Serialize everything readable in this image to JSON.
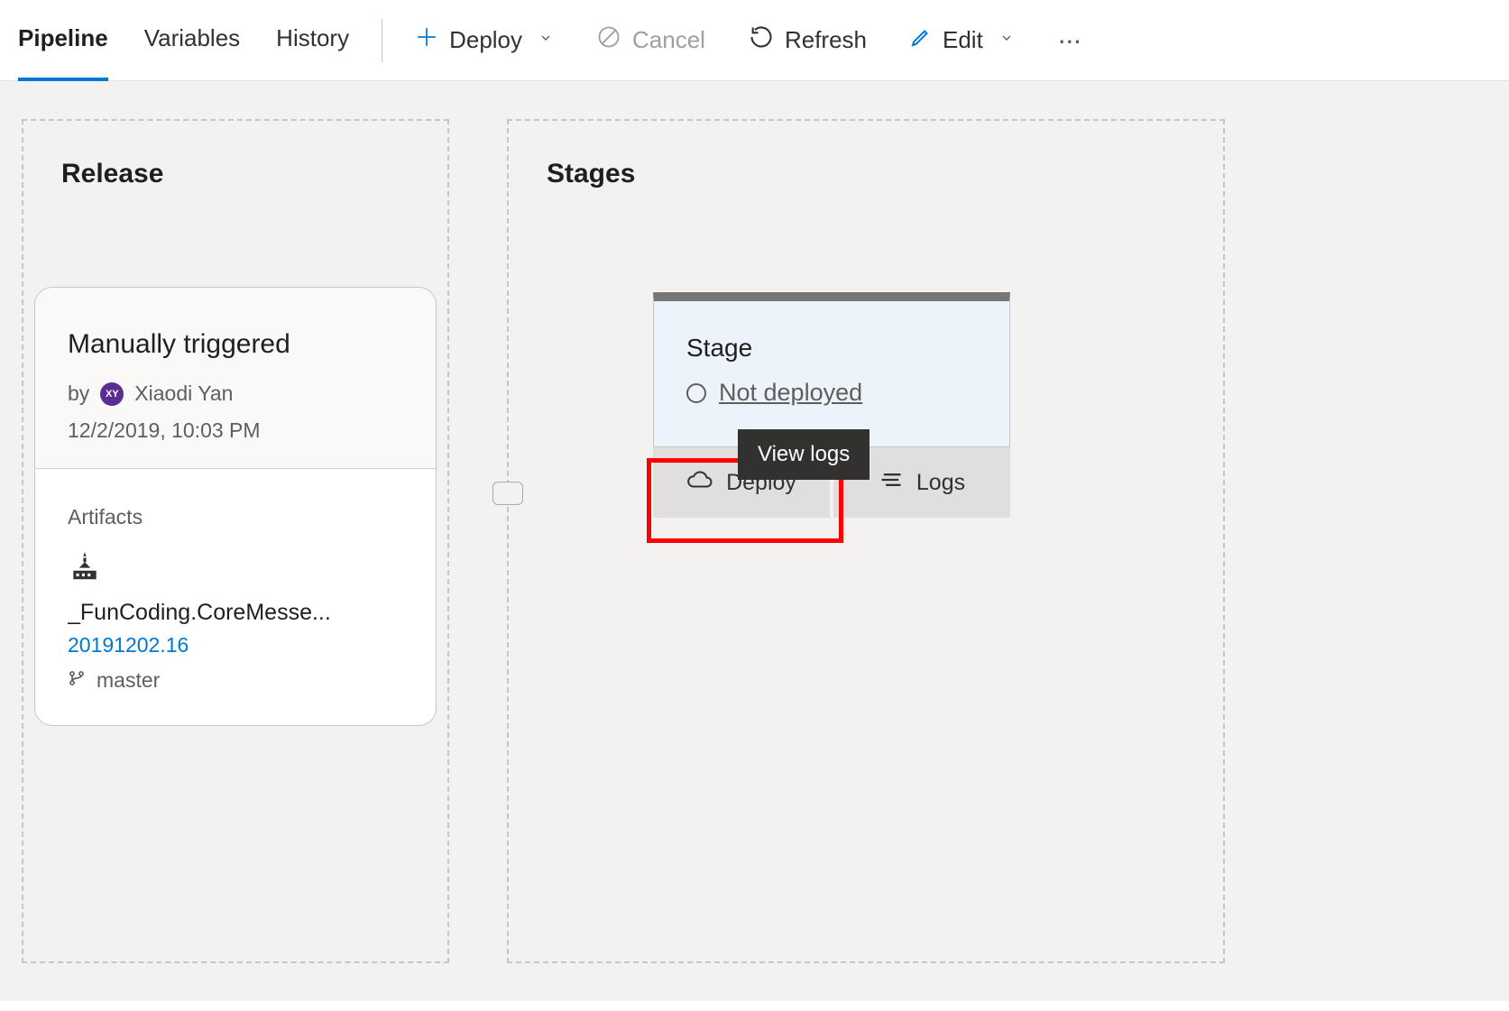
{
  "tabs": {
    "pipeline": "Pipeline",
    "variables": "Variables",
    "history": "History"
  },
  "toolbar": {
    "deploy": "Deploy",
    "cancel": "Cancel",
    "refresh": "Refresh",
    "edit": "Edit"
  },
  "release": {
    "title": "Release",
    "trigger": "Manually triggered",
    "by_label": "by",
    "user": "Xiaodi Yan",
    "avatar_initials": "XY",
    "timestamp": "12/2/2019, 10:03 PM",
    "artifacts_label": "Artifacts",
    "artifact_name": "_FunCoding.CoreMesse...",
    "artifact_version": "20191202.16",
    "artifact_branch": "master"
  },
  "stages": {
    "title": "Stages",
    "stage_name": "Stage",
    "status": "Not deployed",
    "deploy_btn": "Deploy",
    "logs_btn": "Logs",
    "tooltip": "View logs"
  }
}
